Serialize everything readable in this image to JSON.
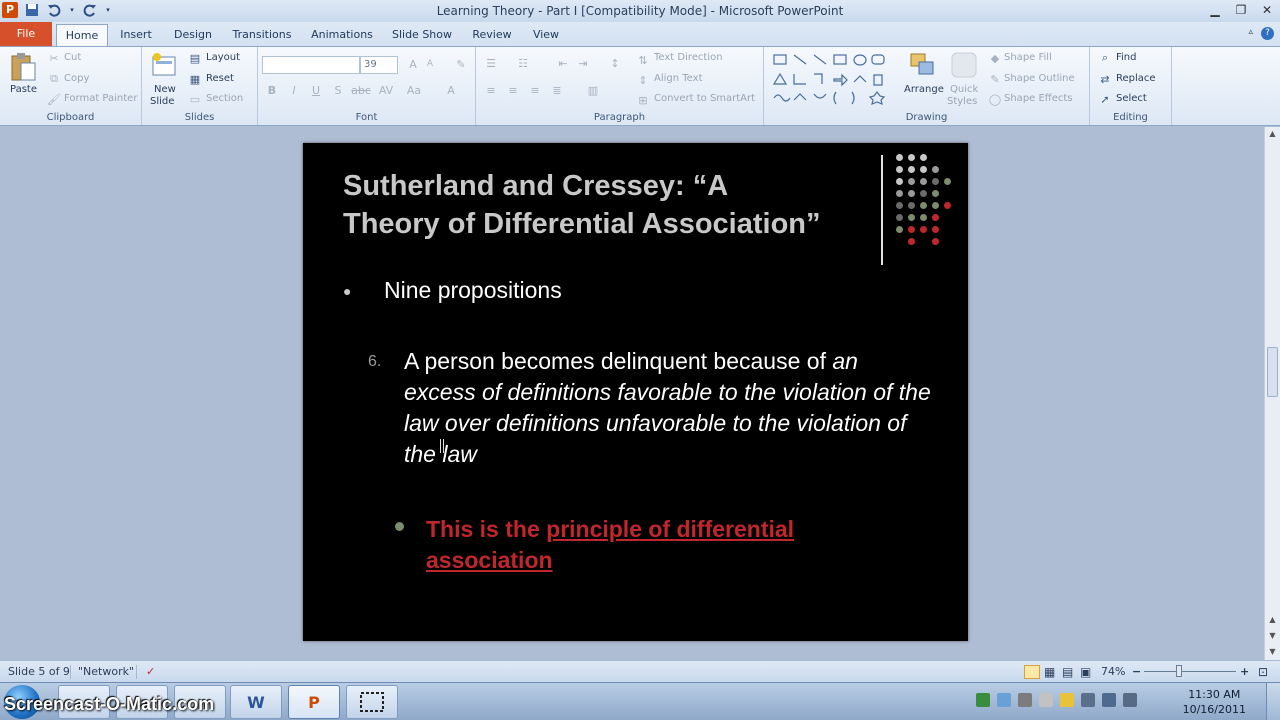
{
  "window": {
    "title": "Learning Theory - Part I [Compatibility Mode] - Microsoft PowerPoint",
    "app_icon_letter": "P",
    "controls": {
      "minimize": "▁",
      "maximize": "❐",
      "close": "✕"
    }
  },
  "tabs": [
    "File",
    "Home",
    "Insert",
    "Design",
    "Transitions",
    "Animations",
    "Slide Show",
    "Review",
    "View"
  ],
  "ribbon": {
    "clipboard": {
      "paste": "Paste",
      "cut": "Cut",
      "copy": "Copy",
      "format_painter": "Format Painter",
      "label": "Clipboard"
    },
    "slides": {
      "new_slide_1": "New",
      "new_slide_2": "Slide",
      "layout": "Layout",
      "reset": "Reset",
      "section": "Section",
      "label": "Slides"
    },
    "font": {
      "font_size": "39",
      "label": "Font"
    },
    "paragraph": {
      "text_direction": "Text Direction",
      "align_text": "Align Text",
      "convert_smartart": "Convert to SmartArt",
      "label": "Paragraph"
    },
    "drawing": {
      "arrange": "Arrange",
      "quick_styles_1": "Quick",
      "quick_styles_2": "Styles",
      "shape_fill": "Shape Fill",
      "shape_outline": "Shape Outline",
      "shape_effects": "Shape Effects",
      "label": "Drawing"
    },
    "editing": {
      "find": "Find",
      "replace": "Replace",
      "select": "Select",
      "label": "Editing"
    }
  },
  "slide": {
    "title_line1": "Sutherland and Cressey: “A",
    "title_line2": "Theory of Differential Association”",
    "bullet": "Nine propositions",
    "item_number": "6.",
    "item_plain": "A person becomes delinquent because of ",
    "item_italic": "an excess of definitions favorable to the violation of the law over definitions unfavorable to the violation of the law",
    "sub_plain": "This is the ",
    "sub_underlined": "principle of differential association"
  },
  "status": {
    "slide_info": "Slide 5 of 9",
    "theme": "\"Network\"",
    "zoom": "74%"
  },
  "taskbar": {
    "watermark": "Screencast-O-Matic.com",
    "time": "11:30 AM",
    "date": "10/16/2011"
  },
  "colors": {
    "slide_bg": "#000000",
    "title_color": "#c8c8c8",
    "accent_red": "#c0272d",
    "file_tab": "#d6502b"
  }
}
